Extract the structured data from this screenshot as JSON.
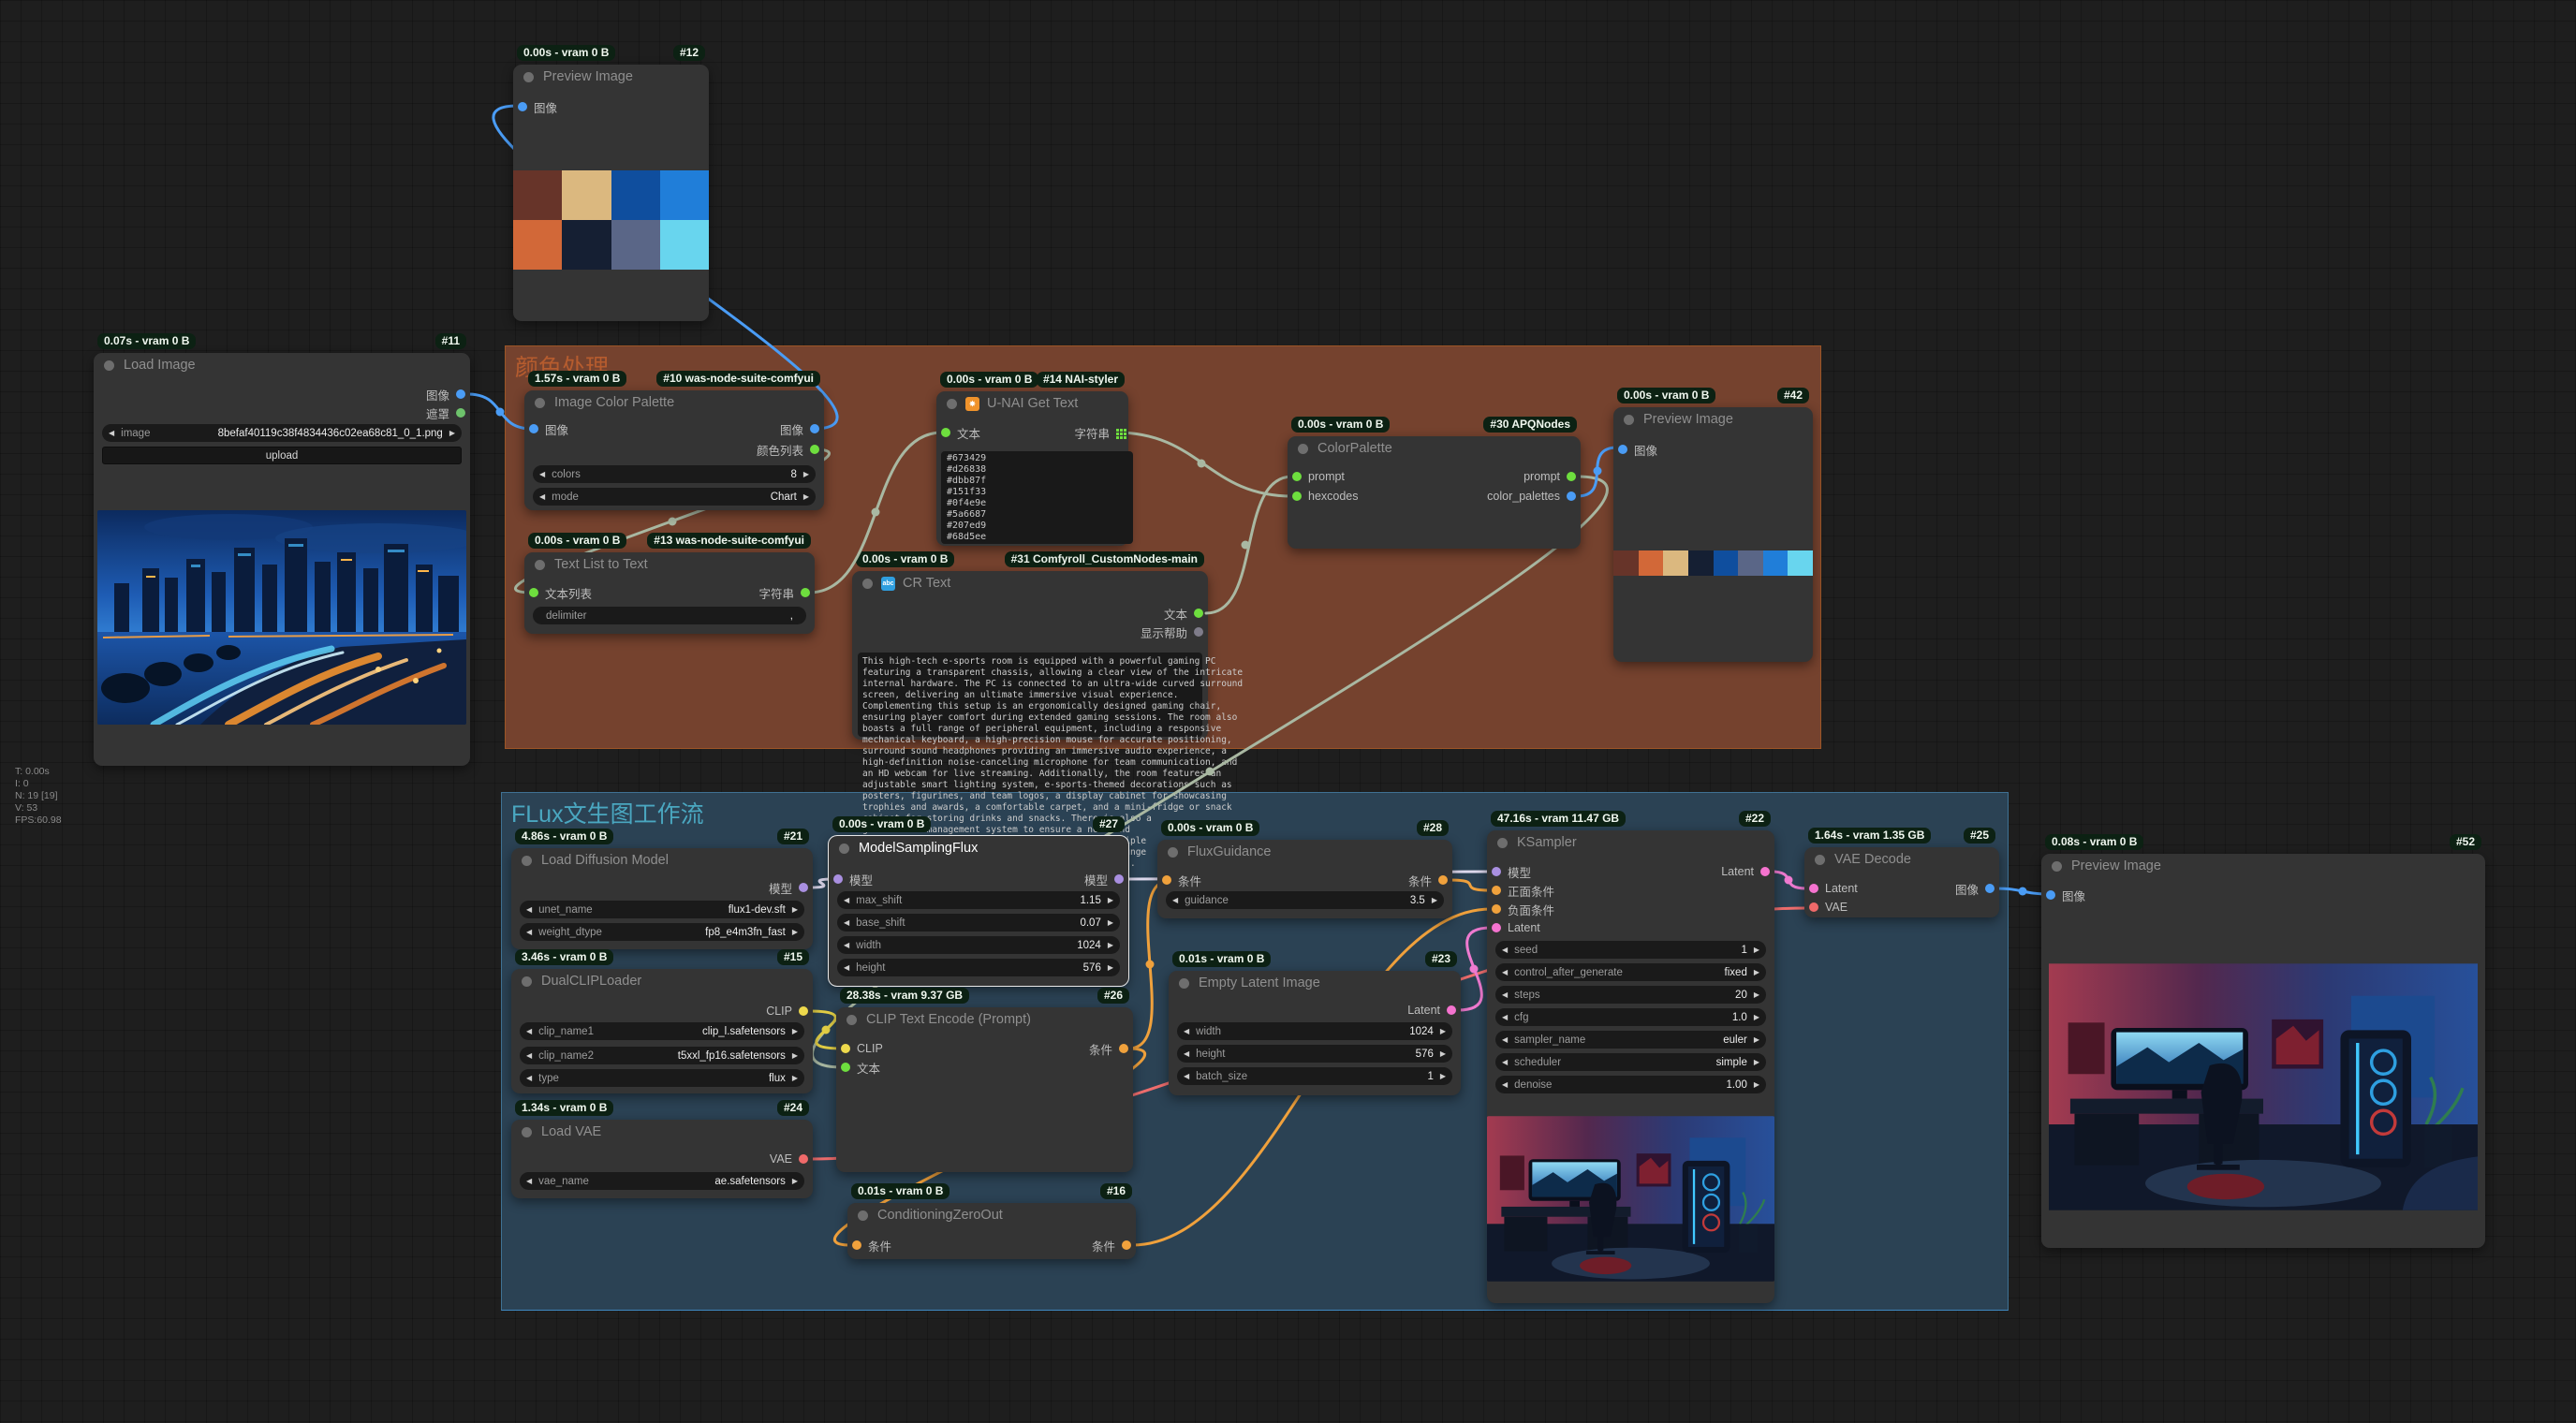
{
  "groups": {
    "color_proc": {
      "title": "颜色处理",
      "title_color": "#b65c2e"
    },
    "flux": {
      "title": "FLux文生图工作流",
      "title_color": "#4aa7c0"
    }
  },
  "stats": {
    "t": "T: 0.00s",
    "i": "I: 0",
    "n": "N: 19 [19]",
    "v": "V: 53",
    "fps": "FPS:60.98"
  },
  "palette": {
    "chart_rows": [
      [
        "#673429",
        "#dbb87f",
        "#0f4e9e",
        "#207ed9"
      ],
      [
        "#d26838",
        "#151f33",
        "#5a6687",
        "#68d5ee"
      ]
    ],
    "strip": [
      "#673429",
      "#d26838",
      "#dbb87f",
      "#151f33",
      "#0f4e9e",
      "#5a6687",
      "#207ed9",
      "#68d5ee"
    ]
  },
  "nodes": {
    "load_image": {
      "time": "0.07s - vram 0 B",
      "id": "#11",
      "title": "Load Image",
      "out_image": "图像",
      "out_mask": "遮罩",
      "w_image_label": "image",
      "w_image_value": "8befaf40119c38f4834436c02ea68c81_0_1.png",
      "upload": "upload"
    },
    "preview12": {
      "time": "0.00s - vram 0 B",
      "id": "#12",
      "title": "Preview Image",
      "in_image": "图像"
    },
    "icp": {
      "time": "1.57s - vram 0 B",
      "id": "#10 was-node-suite-comfyui",
      "title": "Image Color Palette",
      "in_image": "图像",
      "out_image": "图像",
      "out_list": "颜色列表",
      "w": [
        [
          "colors",
          "8"
        ],
        [
          "mode",
          "Chart"
        ]
      ]
    },
    "tlt": {
      "time": "0.00s - vram 0 B",
      "id": "#13 was-node-suite-comfyui",
      "title": "Text List to Text",
      "in": "文本列表",
      "out": "字符串",
      "w": [
        [
          "delimiter",
          ","
        ]
      ]
    },
    "unai": {
      "time": "0.00s - vram 0 B",
      "id": "#14 NAI-styler",
      "title": "U-NAI Get Text",
      "icon": "✸",
      "in": "文本",
      "out": "字符串",
      "text": "#673429\n#d26838\n#dbb87f\n#151f33\n#0f4e9e\n#5a6687\n#207ed9\n#68d5ee"
    },
    "cr_text": {
      "time": "0.00s - vram 0 B",
      "id": "#31 Comfyroll_CustomNodes-main",
      "title": "CR Text",
      "icon": "abc",
      "out_text": "文本",
      "out_help": "显示帮助",
      "text": "This high-tech e-sports room is equipped with a powerful gaming PC\nfeaturing a transparent chassis, allowing a clear view of the intricate\ninternal hardware. The PC is connected to an ultra-wide curved surround\nscreen, delivering an ultimate immersive visual experience.\nComplementing this setup is an ergonomically designed gaming chair,\nensuring player comfort during extended gaming sessions. The room also\nboasts a full range of peripheral equipment, including a responsive\nmechanical keyboard, a high-precision mouse for accurate positioning,\nsurround sound headphones providing an immersive audio experience, a\nhigh-definition noise-canceling microphone for team communication, and\nan HD webcam for live streaming. Additionally, the room features an\nadjustable smart lighting system, e-sports-themed decorations such as\nposters, figurines, and team logos, a display cabinet for showcasing\ntrophies and awards, a comfortable carpet, and a mini-fridge or snack\ncabinet for storing drinks and snacks. There is also a\ngrade cable management system to ensure a neat and\ntidy setup, with space for solo streaming or multiple\nplayers, plus a cozy corner with a bean bag or lounge\nchair, and other personalized e-sports decorations."
    },
    "cpal": {
      "time": "0.00s - vram 0 B",
      "id": "#30 APQNodes",
      "title": "ColorPalette",
      "in_prompt": "prompt",
      "in_hex": "hexcodes",
      "out_prompt": "prompt",
      "out_palettes": "color_palettes"
    },
    "preview42": {
      "time": "0.00s - vram 0 B",
      "id": "#42",
      "title": "Preview Image",
      "in_image": "图像"
    },
    "ldm": {
      "time": "4.86s - vram 0 B",
      "id": "#21",
      "title": "Load Diffusion Model",
      "out": "模型",
      "w": [
        [
          "unet_name",
          "flux1-dev.sft"
        ],
        [
          "weight_dtype",
          "fp8_e4m3fn_fast"
        ]
      ]
    },
    "dclip": {
      "time": "3.46s - vram 0 B",
      "id": "#15",
      "title": "DualCLIPLoader",
      "out": "CLIP",
      "w": [
        [
          "clip_name1",
          "clip_l.safetensors"
        ],
        [
          "clip_name2",
          "t5xxl_fp16.safetensors"
        ],
        [
          "type",
          "flux"
        ]
      ]
    },
    "lvae": {
      "time": "1.34s - vram 0 B",
      "id": "#24",
      "title": "Load VAE",
      "out": "VAE",
      "w": [
        [
          "vae_name",
          "ae.safetensors"
        ]
      ]
    },
    "msf": {
      "time": "0.00s - vram 0 B",
      "id": "#27",
      "title": "ModelSamplingFlux",
      "in": "模型",
      "out": "模型",
      "w": [
        [
          "max_shift",
          "1.15"
        ],
        [
          "base_shift",
          "0.07"
        ],
        [
          "width",
          "1024"
        ],
        [
          "height",
          "576"
        ]
      ]
    },
    "cte": {
      "time": "28.38s - vram 9.37 GB",
      "id": "#26",
      "title": "CLIP Text Encode (Prompt)",
      "in_clip": "CLIP",
      "in_text": "文本",
      "out": "条件"
    },
    "czo": {
      "time": "0.01s - vram 0 B",
      "id": "#16",
      "title": "ConditioningZeroOut",
      "in": "条件",
      "out": "条件"
    },
    "fg": {
      "time": "0.00s - vram 0 B",
      "id": "#28",
      "title": "FluxGuidance",
      "in": "条件",
      "out": "条件",
      "w": [
        [
          "guidance",
          "3.5"
        ]
      ]
    },
    "el": {
      "time": "0.01s - vram 0 B",
      "id": "#23",
      "title": "Empty Latent Image",
      "out": "Latent",
      "w": [
        [
          "width",
          "1024"
        ],
        [
          "height",
          "576"
        ],
        [
          "batch_size",
          "1"
        ]
      ]
    },
    "ks": {
      "time": "47.16s - vram 11.47 GB",
      "id": "#22",
      "title": "KSampler",
      "ins": [
        "模型",
        "正面条件",
        "负面条件",
        "Latent"
      ],
      "out": "Latent",
      "w": [
        [
          "seed",
          "1"
        ],
        [
          "control_after_generate",
          "fixed"
        ],
        [
          "steps",
          "20"
        ],
        [
          "cfg",
          "1.0"
        ],
        [
          "sampler_name",
          "euler"
        ],
        [
          "scheduler",
          "simple"
        ],
        [
          "denoise",
          "1.00"
        ]
      ]
    },
    "vd": {
      "time": "1.64s - vram 1.35 GB",
      "id": "#25",
      "title": "VAE Decode",
      "in_latent": "Latent",
      "in_vae": "VAE",
      "out": "图像"
    },
    "preview52": {
      "time": "0.08s - vram 0 B",
      "id": "#52",
      "title": "Preview Image",
      "in_image": "图像"
    }
  }
}
